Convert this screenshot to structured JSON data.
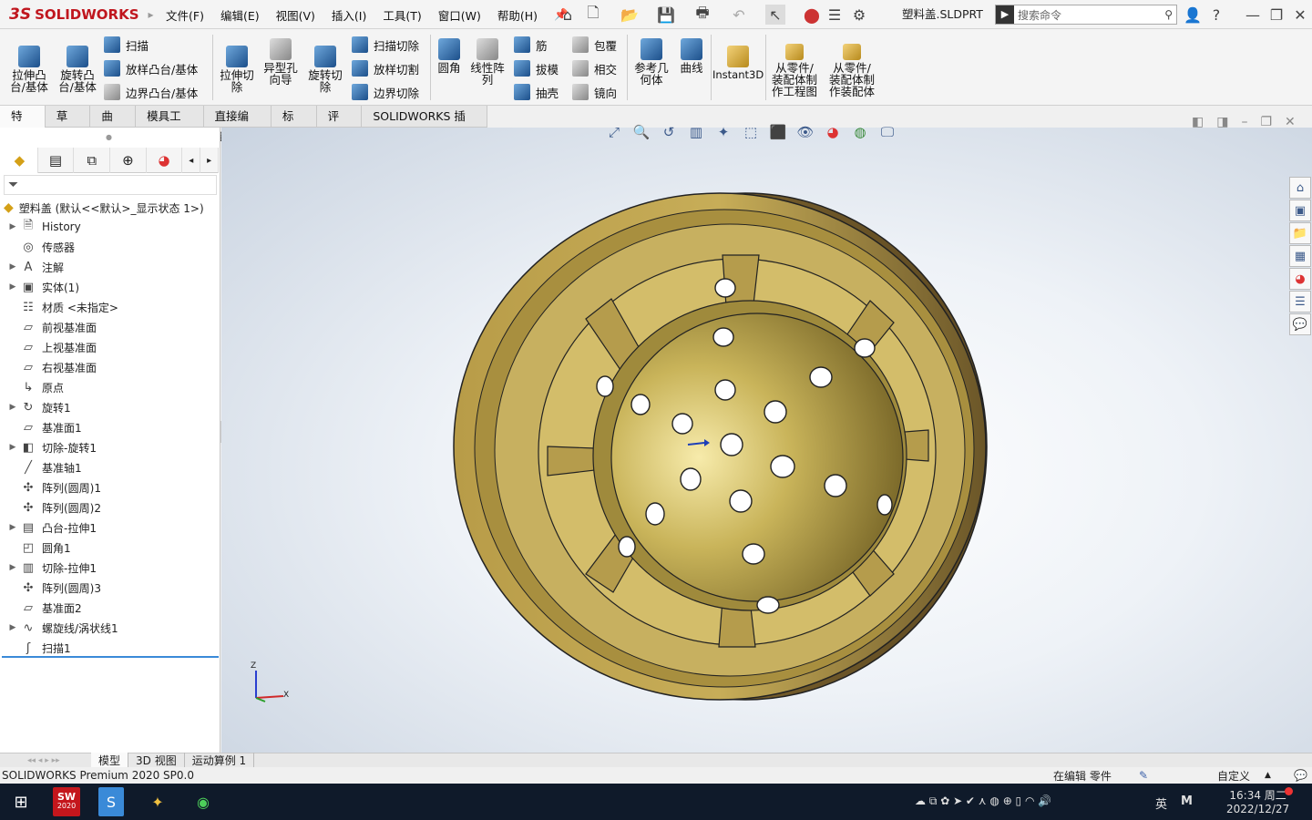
{
  "app": {
    "logo_text": "SOLIDWORKS",
    "logo_prefix": "3S",
    "doc_title": "塑料盖.SLDPRT"
  },
  "menu": [
    "文件(F)",
    "编辑(E)",
    "视图(V)",
    "插入(I)",
    "工具(T)",
    "窗口(W)",
    "帮助(H)"
  ],
  "search": {
    "placeholder": "搜索命令"
  },
  "commands": {
    "extrude_boss": "拉伸凸\n台/基体",
    "revolve_boss": "旋转凸\n台/基体",
    "sweep": "扫描",
    "loft_boss": "放样凸台/基体",
    "boundary_boss": "边界凸台/基体",
    "extrude_cut": "拉伸切\n除",
    "hole_wizard": "异型孔\n向导",
    "revolve_cut": "旋转切\n除",
    "sweep_cut": "扫描切除",
    "loft_cut": "放样切割",
    "boundary_cut": "边界切除",
    "fillet": "圆角",
    "linear_pattern": "线性阵\n列",
    "rib": "筋",
    "draft": "拔模",
    "shell": "抽壳",
    "wrap": "包覆",
    "intersect": "相交",
    "mirror": "镜向",
    "ref_geometry": "参考几\n何体",
    "curves": "曲线",
    "instant3d": "Instant3D",
    "make_drawing": "从零件/\n装配体制\n作工程图",
    "make_assembly": "从零件/\n装配体制\n作装配体"
  },
  "tabs": [
    "特征",
    "草图",
    "曲面",
    "模具工具",
    "直接编辑",
    "标注",
    "评估",
    "SOLIDWORKS 插件"
  ],
  "tree": {
    "root": "塑料盖 (默认<<默认>_显示状态 1>)",
    "items": [
      {
        "label": "History",
        "icon": "history-icon",
        "exp": "▶"
      },
      {
        "label": "传感器",
        "icon": "sensor-icon",
        "exp": ""
      },
      {
        "label": "注解",
        "icon": "annotation-icon",
        "exp": "▶"
      },
      {
        "label": "实体(1)",
        "icon": "solid-body-icon",
        "exp": "▶"
      },
      {
        "label": "材质 <未指定>",
        "icon": "material-icon",
        "exp": ""
      },
      {
        "label": "前视基准面",
        "icon": "plane-icon",
        "exp": ""
      },
      {
        "label": "上视基准面",
        "icon": "plane-icon",
        "exp": ""
      },
      {
        "label": "右视基准面",
        "icon": "plane-icon",
        "exp": ""
      },
      {
        "label": "原点",
        "icon": "origin-icon",
        "exp": ""
      },
      {
        "label": "旋转1",
        "icon": "revolve-icon",
        "exp": "▶"
      },
      {
        "label": "基准面1",
        "icon": "plane-icon",
        "exp": ""
      },
      {
        "label": "切除-旋转1",
        "icon": "revolve-cut-icon",
        "exp": "▶"
      },
      {
        "label": "基准轴1",
        "icon": "axis-icon",
        "exp": ""
      },
      {
        "label": "阵列(圆周)1",
        "icon": "circular-pattern-icon",
        "exp": ""
      },
      {
        "label": "阵列(圆周)2",
        "icon": "circular-pattern-icon",
        "exp": ""
      },
      {
        "label": "凸台-拉伸1",
        "icon": "extrude-boss-icon",
        "exp": "▶"
      },
      {
        "label": "圆角1",
        "icon": "fillet-icon",
        "exp": ""
      },
      {
        "label": "切除-拉伸1",
        "icon": "extrude-cut-icon",
        "exp": "▶"
      },
      {
        "label": "阵列(圆周)3",
        "icon": "circular-pattern-icon",
        "exp": ""
      },
      {
        "label": "基准面2",
        "icon": "plane-icon",
        "exp": ""
      },
      {
        "label": "螺旋线/涡状线1",
        "icon": "helix-icon",
        "exp": "▶"
      },
      {
        "label": "扫描1",
        "icon": "sweep-icon",
        "exp": ""
      }
    ]
  },
  "axis": {
    "z": "Z",
    "x": "X"
  },
  "bottom_tabs": [
    "模型",
    "3D 视图",
    "运动算例 1"
  ],
  "status": {
    "left": "SOLIDWORKS Premium 2020 SP0.0",
    "editing": "在编辑 零件",
    "custom": "自定义"
  },
  "taskbar": {
    "time": "16:34 周二",
    "date": "2022/12/27",
    "ime": "英",
    "sw_badge": "2020"
  }
}
